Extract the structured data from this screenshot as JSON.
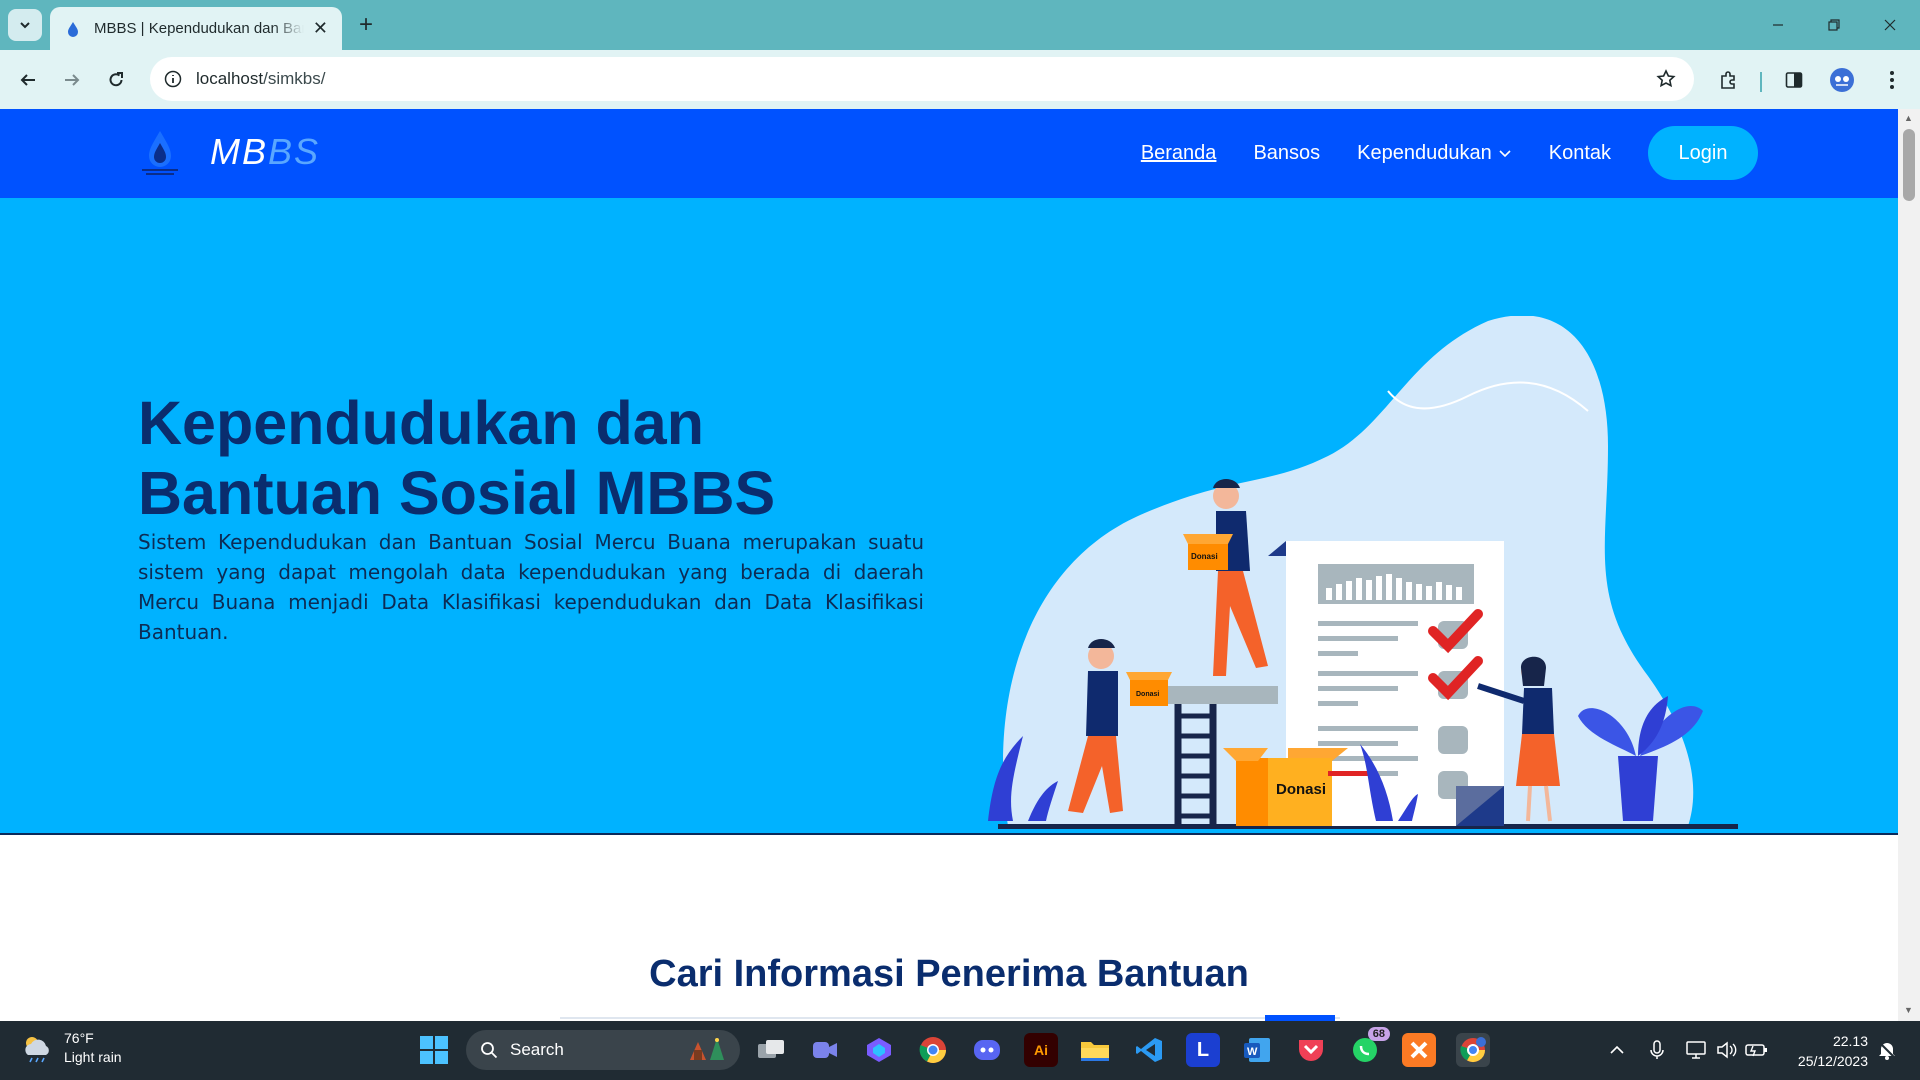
{
  "browser": {
    "tab_title": "MBBS | Kependudukan dan Bantuan Sosial",
    "url_host": "localhost",
    "url_path": "/simkbs/"
  },
  "site": {
    "logo_mb": "MB",
    "logo_bs": "BS",
    "nav": {
      "beranda": "Beranda",
      "bansos": "Bansos",
      "kependudukan": "Kependudukan",
      "kontak": "Kontak",
      "login": "Login"
    },
    "hero": {
      "title": "Kependudukan dan Bantuan Sosial MBBS",
      "description": "Sistem Kependudukan dan Bantuan Sosial Mercu Buana merupakan suatu sistem yang dapat mengolah data kependudukan yang berada di daerah Mercu Buana menjadi Data Klasifikasi kependudukan dan Data Klasifikasi Bantuan.",
      "box_label": "Donasi"
    },
    "section_title": "Cari Informasi Penerima Bantuan"
  },
  "taskbar": {
    "temperature": "76°F",
    "weather": "Light rain",
    "search_label": "Search",
    "whatsapp_badge": "68",
    "time": "22.13",
    "date": "25/12/2023"
  },
  "colors": {
    "header_blue": "#0052ff",
    "hero_cyan": "#00b2ff",
    "title_navy": "#0a2d6e",
    "login_button": "#00b2ff"
  }
}
